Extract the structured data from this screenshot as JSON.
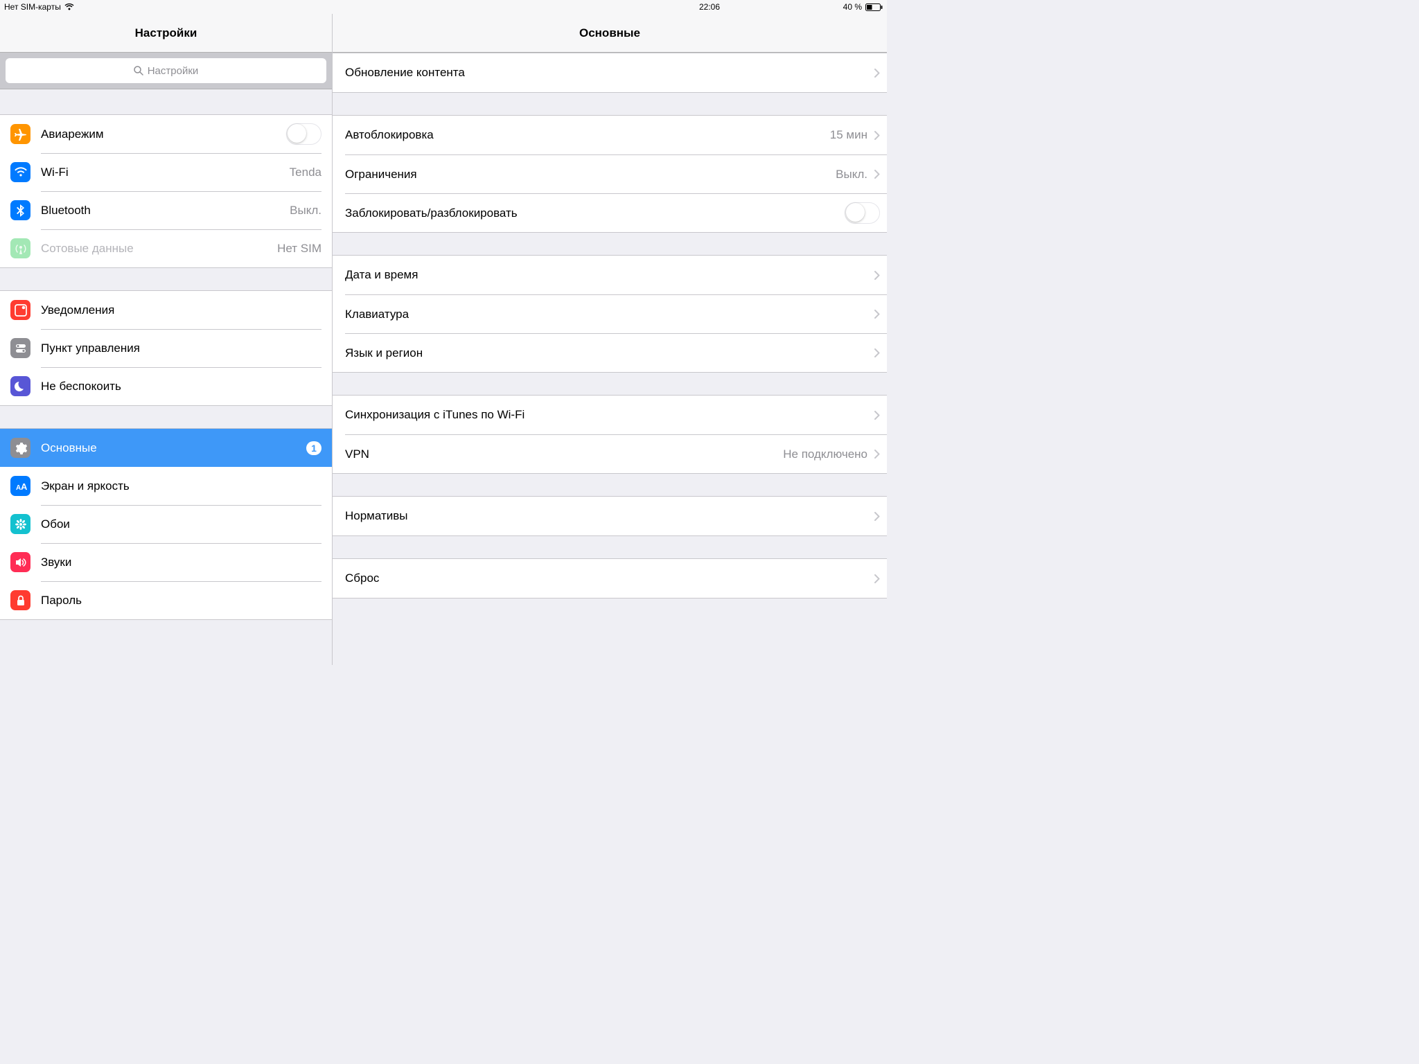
{
  "status": {
    "carrier": "Нет SIM-карты",
    "time": "22:06",
    "battery": "40 %"
  },
  "sidebar": {
    "title": "Настройки",
    "search_placeholder": "Настройки",
    "groups": [
      {
        "rows": [
          {
            "key": "airplane",
            "label": "Авиарежим",
            "toggle": false
          },
          {
            "key": "wifi",
            "label": "Wi-Fi",
            "value": "Tenda"
          },
          {
            "key": "bluetooth",
            "label": "Bluetooth",
            "value": "Выкл."
          },
          {
            "key": "cellular",
            "label": "Сотовые данные",
            "value": "Нет SIM",
            "disabled": true
          }
        ]
      },
      {
        "rows": [
          {
            "key": "notifications",
            "label": "Уведомления"
          },
          {
            "key": "control-center",
            "label": "Пункт управления"
          },
          {
            "key": "dnd",
            "label": "Не беспокоить"
          }
        ]
      },
      {
        "rows": [
          {
            "key": "general",
            "label": "Основные",
            "selected": true,
            "badge": "1"
          },
          {
            "key": "display",
            "label": "Экран и яркость"
          },
          {
            "key": "wallpaper",
            "label": "Обои"
          },
          {
            "key": "sounds",
            "label": "Звуки"
          },
          {
            "key": "passcode",
            "label": "Пароль"
          }
        ]
      }
    ]
  },
  "detail": {
    "title": "Основные",
    "groups": [
      {
        "rows": [
          {
            "key": "background-refresh",
            "label": "Обновление контента",
            "chevron": true
          }
        ]
      },
      {
        "rows": [
          {
            "key": "auto-lock",
            "label": "Автоблокировка",
            "value": "15 мин",
            "chevron": true
          },
          {
            "key": "restrictions",
            "label": "Ограничения",
            "value": "Выкл.",
            "chevron": true
          },
          {
            "key": "lock-unlock",
            "label": "Заблокировать/разблокировать",
            "toggle": false
          }
        ]
      },
      {
        "rows": [
          {
            "key": "date-time",
            "label": "Дата и время",
            "chevron": true
          },
          {
            "key": "keyboard",
            "label": "Клавиатура",
            "chevron": true
          },
          {
            "key": "language",
            "label": "Язык и регион",
            "chevron": true
          }
        ]
      },
      {
        "rows": [
          {
            "key": "itunes-wifi-sync",
            "label": "Синхронизация с iTunes по Wi-Fi",
            "chevron": true
          },
          {
            "key": "vpn",
            "label": "VPN",
            "value": "Не подключено",
            "chevron": true
          }
        ]
      },
      {
        "rows": [
          {
            "key": "regulatory",
            "label": "Нормативы",
            "chevron": true
          }
        ]
      },
      {
        "rows": [
          {
            "key": "reset",
            "label": "Сброс",
            "chevron": true
          }
        ]
      }
    ]
  },
  "icons": {
    "airplane": {
      "bg": "#ff9500",
      "glyph": "airplane"
    },
    "wifi": {
      "bg": "#007aff",
      "glyph": "wifi"
    },
    "bluetooth": {
      "bg": "#007aff",
      "glyph": "bluetooth"
    },
    "cellular": {
      "bg": "#a3e8b5",
      "glyph": "antenna",
      "faded": true
    },
    "notifications": {
      "bg": "#ff3b30",
      "glyph": "notifications"
    },
    "control-center": {
      "bg": "#8e8e93",
      "glyph": "switches"
    },
    "dnd": {
      "bg": "#5856d6",
      "glyph": "moon"
    },
    "general": {
      "bg": "#8e8e93",
      "glyph": "gear"
    },
    "display": {
      "bg": "#007aff",
      "glyph": "text-size"
    },
    "wallpaper": {
      "bg": "#13c1cf",
      "glyph": "flower"
    },
    "sounds": {
      "bg": "#ff2d55",
      "glyph": "speaker"
    },
    "passcode": {
      "bg": "#ff3b30",
      "glyph": "lock"
    }
  }
}
